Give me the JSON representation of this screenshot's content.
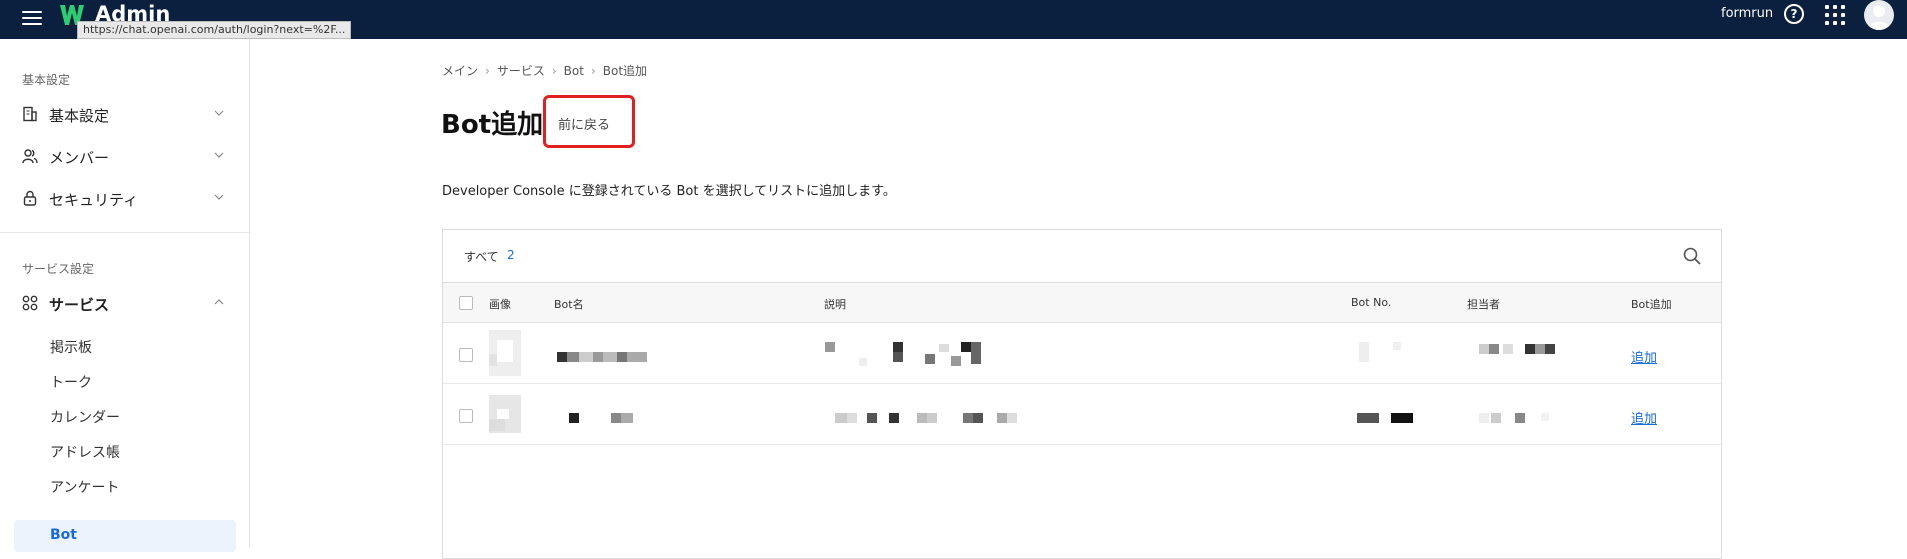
{
  "app": {
    "title": "Admin",
    "user_name": "formrun",
    "hover_url": "https://chat.openai.com/auth/login?next=%2F..."
  },
  "colors": {
    "topbar": "#0b1f3f",
    "accent": "#1a6bd6",
    "highlight_border": "#e02020"
  },
  "sidebar": {
    "section1_label": "基本設定",
    "items": [
      {
        "label": "基本設定",
        "icon": "building-icon"
      },
      {
        "label": "メンバー",
        "icon": "members-icon"
      },
      {
        "label": "セキュリティ",
        "icon": "lock-icon"
      }
    ],
    "section2_label": "サービス設定",
    "service": {
      "label": "サービス",
      "icon": "grid-icon"
    },
    "sub_items": [
      "掲示板",
      "トーク",
      "カレンダー",
      "アドレス帳",
      "アンケート",
      "Bot"
    ]
  },
  "breadcrumb": [
    "メイン",
    "サービス",
    "Bot",
    "Bot追加"
  ],
  "page": {
    "title": "Bot追加",
    "back_button": "前に戻る",
    "description": "Developer Console に登録されている Bot を選択してリストに追加します。"
  },
  "table": {
    "filter_label": "すべて",
    "filter_count": "2",
    "columns": [
      "画像",
      "Bot名",
      "説明",
      "Bot No.",
      "担当者",
      "Bot追加"
    ],
    "rows": [
      {
        "add_label": "追加"
      },
      {
        "add_label": "追加"
      }
    ]
  }
}
